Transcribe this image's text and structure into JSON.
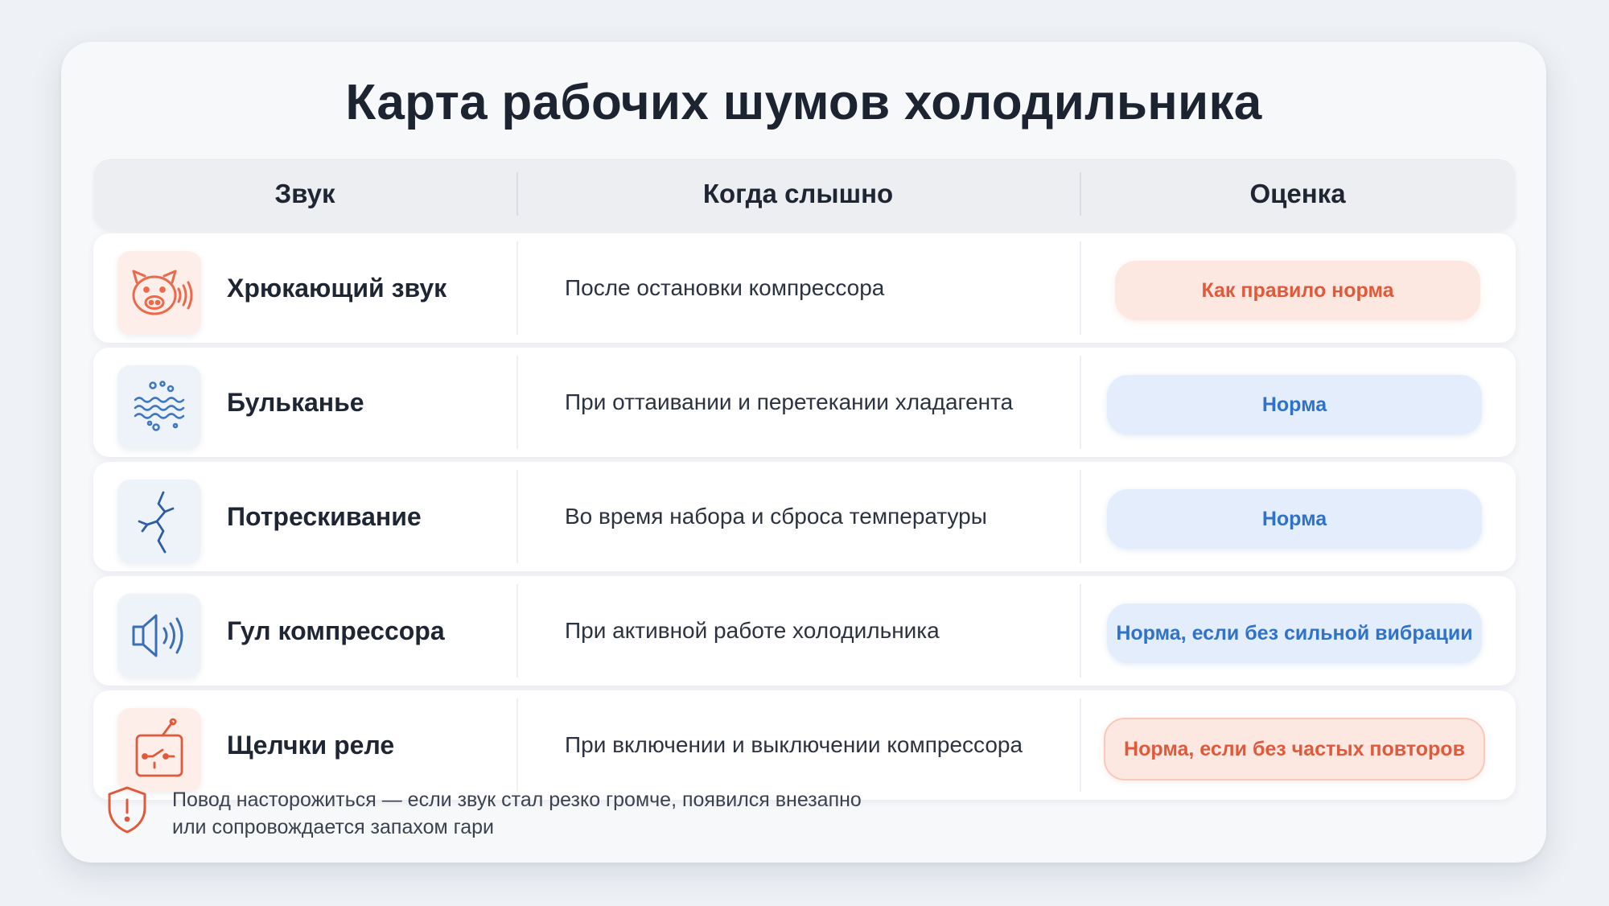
{
  "title": "Карта рабочих шумов холодильника",
  "header": {
    "col_sound": "Звук",
    "col_when": "Когда слышно",
    "col_rating": "Оценка"
  },
  "rows": [
    {
      "sound": "Хрюкающий звук",
      "when": "После остановки компрессора",
      "rating": "Как правило норма",
      "rating_tone": "warm",
      "icon": "pig-icon"
    },
    {
      "sound": "Бульканье",
      "when": "При оттаивании и перетекании хладагента",
      "rating": "Норма",
      "rating_tone": "cool",
      "icon": "bubbles-icon"
    },
    {
      "sound": "Потрескивание",
      "when": "Во время набора и сброса температуры",
      "rating": "Норма",
      "rating_tone": "cool",
      "icon": "crack-icon"
    },
    {
      "sound": "Гул компрессора",
      "when": "При активной работе холодильника",
      "rating": "Норма, если без сильной вибрации",
      "rating_tone": "cool",
      "icon": "speaker-icon"
    },
    {
      "sound": "Щелчки реле",
      "when": "При включении и выключении компрессора",
      "rating": "Норма, если без частых повторов",
      "rating_tone": "warm",
      "icon": "relay-icon"
    }
  ],
  "footer": {
    "icon": "shield-warning-icon",
    "line1": "Повод насторожиться — если звук стал резко громче, появился внезапно",
    "line2": "или сопровождается запахом гари"
  },
  "colors": {
    "warm_accent": "#e0593a",
    "cool_accent": "#2f72c9",
    "title": "#1c2432"
  }
}
